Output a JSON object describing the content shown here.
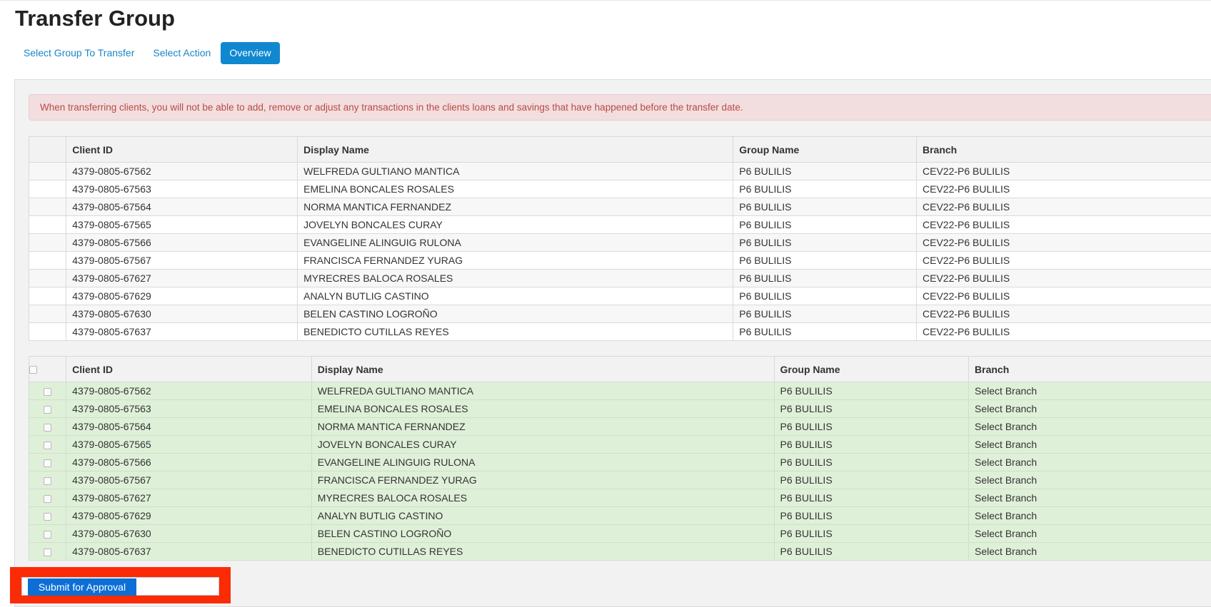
{
  "page": {
    "title": "Transfer Group"
  },
  "wizard": {
    "tabs": [
      {
        "label": "Select Group To Transfer",
        "active": false
      },
      {
        "label": "Select Action",
        "active": false
      },
      {
        "label": "Overview",
        "active": true
      }
    ]
  },
  "alert": {
    "text": "When transferring clients, you will not be able to add, remove or adjust any transactions in the clients loans and savings that have happened before the transfer date."
  },
  "source_table": {
    "columns": [
      "",
      "Client ID",
      "Display Name",
      "Group Name",
      "Branch"
    ],
    "rows": [
      {
        "client_id": "4379-0805-67562",
        "display_name": "WELFREDA GULTIANO MANTICA",
        "group_name": "P6 BULILIS",
        "branch": "CEV22-P6 BULILIS"
      },
      {
        "client_id": "4379-0805-67563",
        "display_name": "EMELINA BONCALES ROSALES",
        "group_name": "P6 BULILIS",
        "branch": "CEV22-P6 BULILIS"
      },
      {
        "client_id": "4379-0805-67564",
        "display_name": "NORMA MANTICA FERNANDEZ",
        "group_name": "P6 BULILIS",
        "branch": "CEV22-P6 BULILIS"
      },
      {
        "client_id": "4379-0805-67565",
        "display_name": "JOVELYN BONCALES CURAY",
        "group_name": "P6 BULILIS",
        "branch": "CEV22-P6 BULILIS"
      },
      {
        "client_id": "4379-0805-67566",
        "display_name": "EVANGELINE ALINGUIG RULONA",
        "group_name": "P6 BULILIS",
        "branch": "CEV22-P6 BULILIS"
      },
      {
        "client_id": "4379-0805-67567",
        "display_name": "FRANCISCA FERNANDEZ YURAG",
        "group_name": "P6 BULILIS",
        "branch": "CEV22-P6 BULILIS"
      },
      {
        "client_id": "4379-0805-67627",
        "display_name": "MYRECRES BALOCA ROSALES",
        "group_name": "P6 BULILIS",
        "branch": "CEV22-P6 BULILIS"
      },
      {
        "client_id": "4379-0805-67629",
        "display_name": "ANALYN BUTLIG CASTINO",
        "group_name": "P6 BULILIS",
        "branch": "CEV22-P6 BULILIS"
      },
      {
        "client_id": "4379-0805-67630",
        "display_name": "BELEN CASTINO LOGROÑO",
        "group_name": "P6 BULILIS",
        "branch": "CEV22-P6 BULILIS"
      },
      {
        "client_id": "4379-0805-67637",
        "display_name": "BENEDICTO CUTILLAS REYES",
        "group_name": "P6 BULILIS",
        "branch": "CEV22-P6 BULILIS"
      }
    ]
  },
  "dest_table": {
    "columns": [
      "",
      "Client ID",
      "Display Name",
      "Group Name",
      "Branch"
    ],
    "rows": [
      {
        "client_id": "4379-0805-67562",
        "display_name": "WELFREDA GULTIANO MANTICA",
        "group_name": "P6 BULILIS",
        "branch": "Select Branch"
      },
      {
        "client_id": "4379-0805-67563",
        "display_name": "EMELINA BONCALES ROSALES",
        "group_name": "P6 BULILIS",
        "branch": "Select Branch"
      },
      {
        "client_id": "4379-0805-67564",
        "display_name": "NORMA MANTICA FERNANDEZ",
        "group_name": "P6 BULILIS",
        "branch": "Select Branch"
      },
      {
        "client_id": "4379-0805-67565",
        "display_name": "JOVELYN BONCALES CURAY",
        "group_name": "P6 BULILIS",
        "branch": "Select Branch"
      },
      {
        "client_id": "4379-0805-67566",
        "display_name": "EVANGELINE ALINGUIG RULONA",
        "group_name": "P6 BULILIS",
        "branch": "Select Branch"
      },
      {
        "client_id": "4379-0805-67567",
        "display_name": "FRANCISCA FERNANDEZ YURAG",
        "group_name": "P6 BULILIS",
        "branch": "Select Branch"
      },
      {
        "client_id": "4379-0805-67627",
        "display_name": "MYRECRES BALOCA ROSALES",
        "group_name": "P6 BULILIS",
        "branch": "Select Branch"
      },
      {
        "client_id": "4379-0805-67629",
        "display_name": "ANALYN BUTLIG CASTINO",
        "group_name": "P6 BULILIS",
        "branch": "Select Branch"
      },
      {
        "client_id": "4379-0805-67630",
        "display_name": "BELEN CASTINO LOGROÑO",
        "group_name": "P6 BULILIS",
        "branch": "Select Branch"
      },
      {
        "client_id": "4379-0805-67637",
        "display_name": "BENEDICTO CUTILLAS REYES",
        "group_name": "P6 BULILIS",
        "branch": "Select Branch"
      }
    ]
  },
  "actions": {
    "submit_label": "Submit for Approval"
  },
  "colors": {
    "tab_active_bg": "#0f88d0",
    "link": "#1a86c7",
    "alert_bg": "#f2dede",
    "alert_text": "#b94a48",
    "selected_row_bg": "#dff0d8",
    "submit_bg": "#0c6fd6",
    "highlight_box": "#fb2b06"
  }
}
